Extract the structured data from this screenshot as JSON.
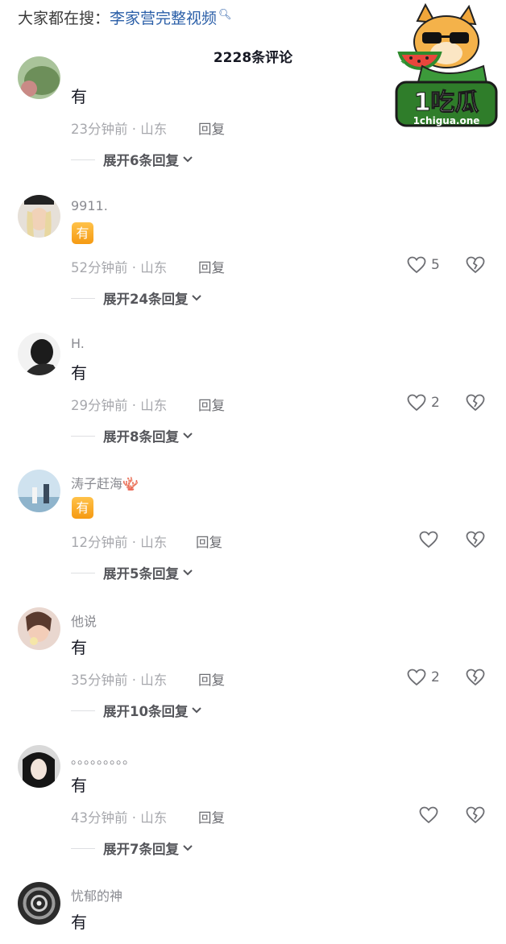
{
  "search": {
    "label": "大家都在搜：",
    "term": "李家营完整视频",
    "icon": "search-icon"
  },
  "header": {
    "comment_count": "2228条评论"
  },
  "comments": [
    {
      "username": "",
      "content": "有",
      "content_type": "text",
      "time_loc": "23分钟前 · 山东",
      "reply": "回复",
      "likes": "",
      "expand": "展开6条回复"
    },
    {
      "username": "9911.",
      "content": "有",
      "content_type": "badge",
      "time_loc": "52分钟前 · 山东",
      "reply": "回复",
      "likes": "5",
      "expand": "展开24条回复"
    },
    {
      "username": "H.",
      "content": "有",
      "content_type": "text",
      "time_loc": "29分钟前 · 山东",
      "reply": "回复",
      "likes": "2",
      "expand": "展开8条回复"
    },
    {
      "username": "涛子赶海🪸",
      "content": "有",
      "content_type": "badge",
      "time_loc": "12分钟前 · 山东",
      "reply": "回复",
      "likes": "",
      "expand": "展开5条回复"
    },
    {
      "username": "他说",
      "content": "有",
      "content_type": "text",
      "time_loc": "35分钟前 · 山东",
      "reply": "回复",
      "likes": "2",
      "expand": "展开10条回复"
    },
    {
      "username": "。。。。。。。。。",
      "content": "有",
      "content_type": "text",
      "time_loc": "43分钟前 · 山东",
      "reply": "回复",
      "likes": "",
      "expand": "展开7条回复"
    },
    {
      "username": "忧郁的神",
      "content": "有",
      "content_type": "text",
      "time_loc": "",
      "reply": "",
      "likes": "",
      "expand": ""
    }
  ],
  "watermark": {
    "brand": "1吃瓜",
    "url": "1chigua.one"
  },
  "colors": {
    "link": "#2b5fa8",
    "badge": "#f5a623",
    "muted": "#a7a8ad"
  }
}
